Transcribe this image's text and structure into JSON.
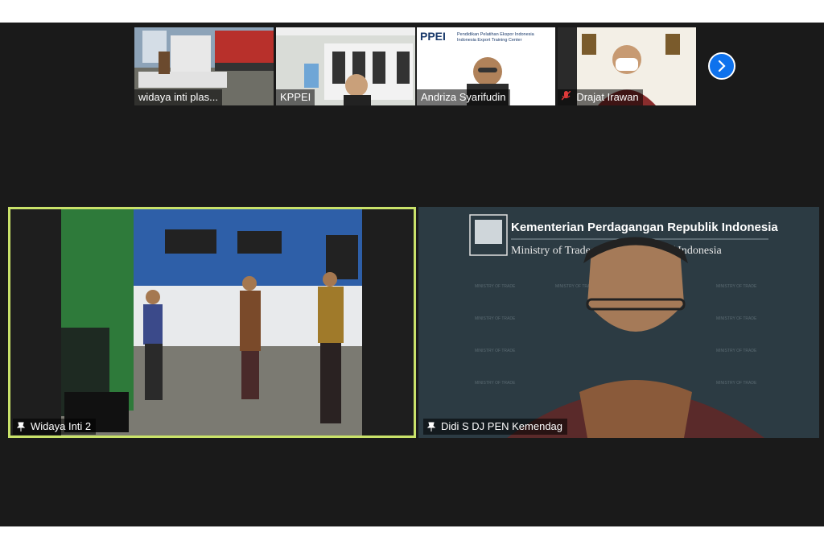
{
  "participants_strip": [
    {
      "name": "widaya inti plas...",
      "muted": false
    },
    {
      "name": "KPPEI",
      "muted": false
    },
    {
      "name": "Andriza Syarifudin",
      "muted": false
    },
    {
      "name": "Drajat Irawan",
      "muted": true
    }
  ],
  "ppei_card": {
    "logo": "PPEI",
    "line1": "Pendidikan Pelatihan Ekspor Indonesia",
    "line2": "Indonesia Export Training Center"
  },
  "main_tiles": [
    {
      "name": "Widaya Inti 2",
      "active": true
    },
    {
      "name": "Didi S DJ PEN Kemendag",
      "active": false
    }
  ],
  "ministry_banner": {
    "line1": "Kementerian Perdagangan Republik Indonesia",
    "line2": "Ministry of Trade of the Republic of Indonesia",
    "watermark": "MINISTRY OF TRADE"
  },
  "colors": {
    "active_border": "#c9e26a",
    "accent_blue": "#0e72ed",
    "muted_red": "#e03a3a"
  },
  "icons": {
    "next_page": "chevron-right-icon",
    "pin": "pin-icon",
    "mic_muted": "mic-off-icon"
  }
}
